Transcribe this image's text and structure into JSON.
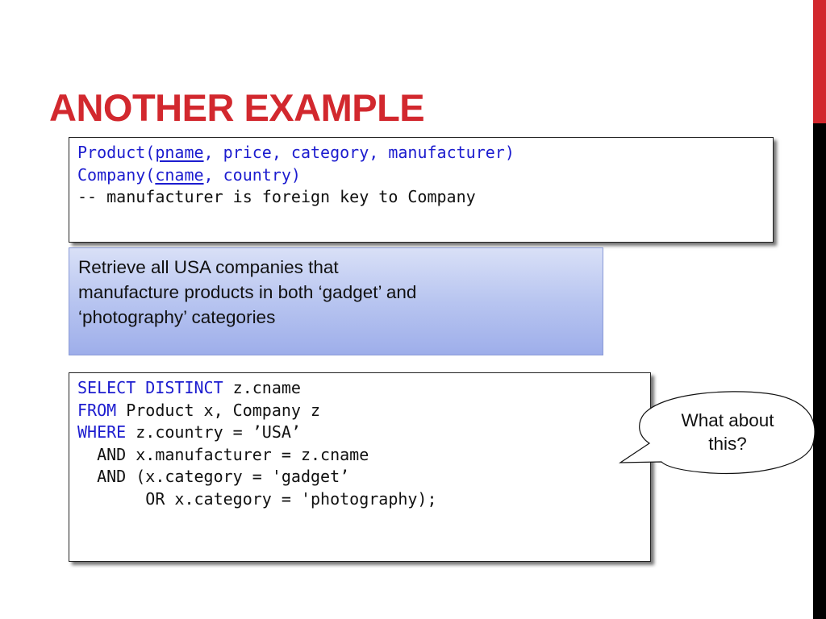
{
  "slide": {
    "title": "ANOTHER EXAMPLE",
    "accent_color": "#d2282e"
  },
  "schema": {
    "lines": [
      {
        "parts": [
          {
            "text": "Product(",
            "style": "blue"
          },
          {
            "text": "pname",
            "style": "blue-underline"
          },
          {
            "text": ", price, category, manufacturer)",
            "style": "blue"
          }
        ]
      },
      {
        "parts": [
          {
            "text": "Company(",
            "style": "blue"
          },
          {
            "text": "cname",
            "style": "blue-underline"
          },
          {
            "text": ", country)",
            "style": "blue"
          }
        ]
      },
      {
        "parts": [
          {
            "text": "-- manufacturer is foreign key to Company",
            "style": "plain"
          }
        ]
      }
    ]
  },
  "task": {
    "text": "Retrieve all USA companies that\nmanufacture products in both ‘gadget’ and\n‘photography’ categories"
  },
  "sql": {
    "lines": [
      {
        "keyword": "SELECT DISTINCT",
        "rest": " z.cname"
      },
      {
        "keyword": "FROM",
        "rest": " Product x, Company z"
      },
      {
        "keyword": "WHERE",
        "rest": " z.country = ’USA’"
      },
      {
        "keyword": "",
        "rest": "  AND x.manufacturer = z.cname"
      },
      {
        "keyword": "",
        "rest": "  AND (x.category = 'gadget’"
      },
      {
        "keyword": "",
        "rest": "       OR x.category = 'photography);"
      }
    ]
  },
  "callout": {
    "text": "What about\nthis?"
  }
}
